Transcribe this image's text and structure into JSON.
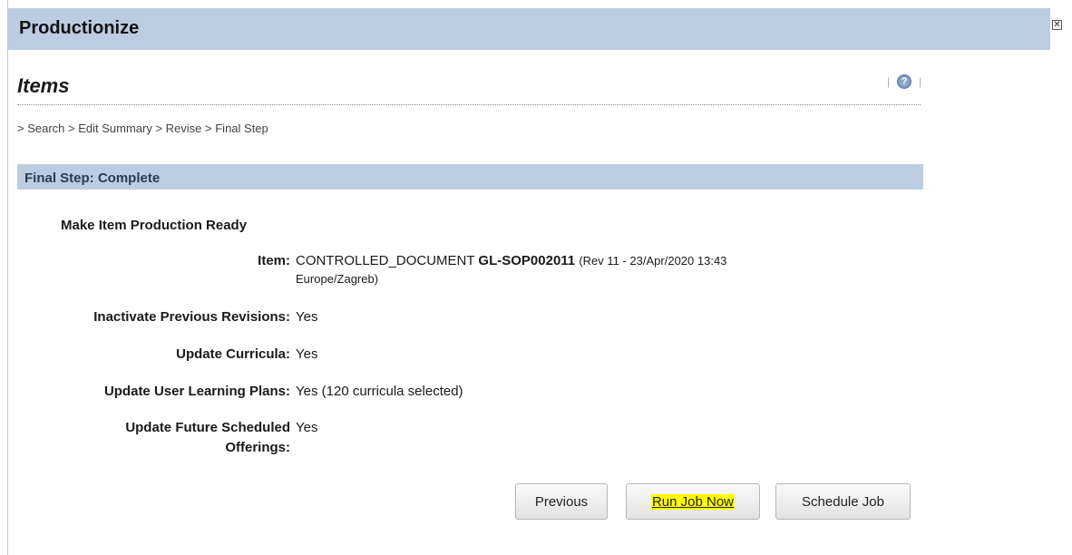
{
  "window": {
    "title": "Productionize",
    "close_glyph": "✕"
  },
  "header": {
    "section_title": "Items",
    "help_icon": "help-icon",
    "separator": "|"
  },
  "breadcrumb": [
    "> Search",
    " > Edit Summary",
    " > Revise",
    " > Final Step"
  ],
  "step": {
    "label": "Final Step: Complete"
  },
  "form": {
    "heading": "Make Item Production Ready",
    "item": {
      "label": "Item:",
      "type": "CONTROLLED_DOCUMENT",
      "id": "GL-SOP002011",
      "revision_line1": "(Rev 11 - 23/Apr/2020 13:43",
      "revision_line2": "Europe/Zagreb)"
    },
    "inactivate": {
      "label": "Inactivate Previous Revisions:",
      "value": "Yes"
    },
    "curricula": {
      "label": "Update Curricula:",
      "value": "Yes"
    },
    "learning_plans": {
      "label": "Update User Learning Plans:",
      "value": "Yes (120 curricula selected)"
    },
    "future_offerings": {
      "label_line1": "Update Future Scheduled",
      "label_line2": "Offerings:",
      "value": "Yes"
    }
  },
  "buttons": {
    "previous": "Previous",
    "run_job_now": "Run Job Now",
    "schedule_job": "Schedule Job"
  },
  "colors": {
    "title_bar": "#bccde2",
    "highlight": "#ffff00"
  }
}
